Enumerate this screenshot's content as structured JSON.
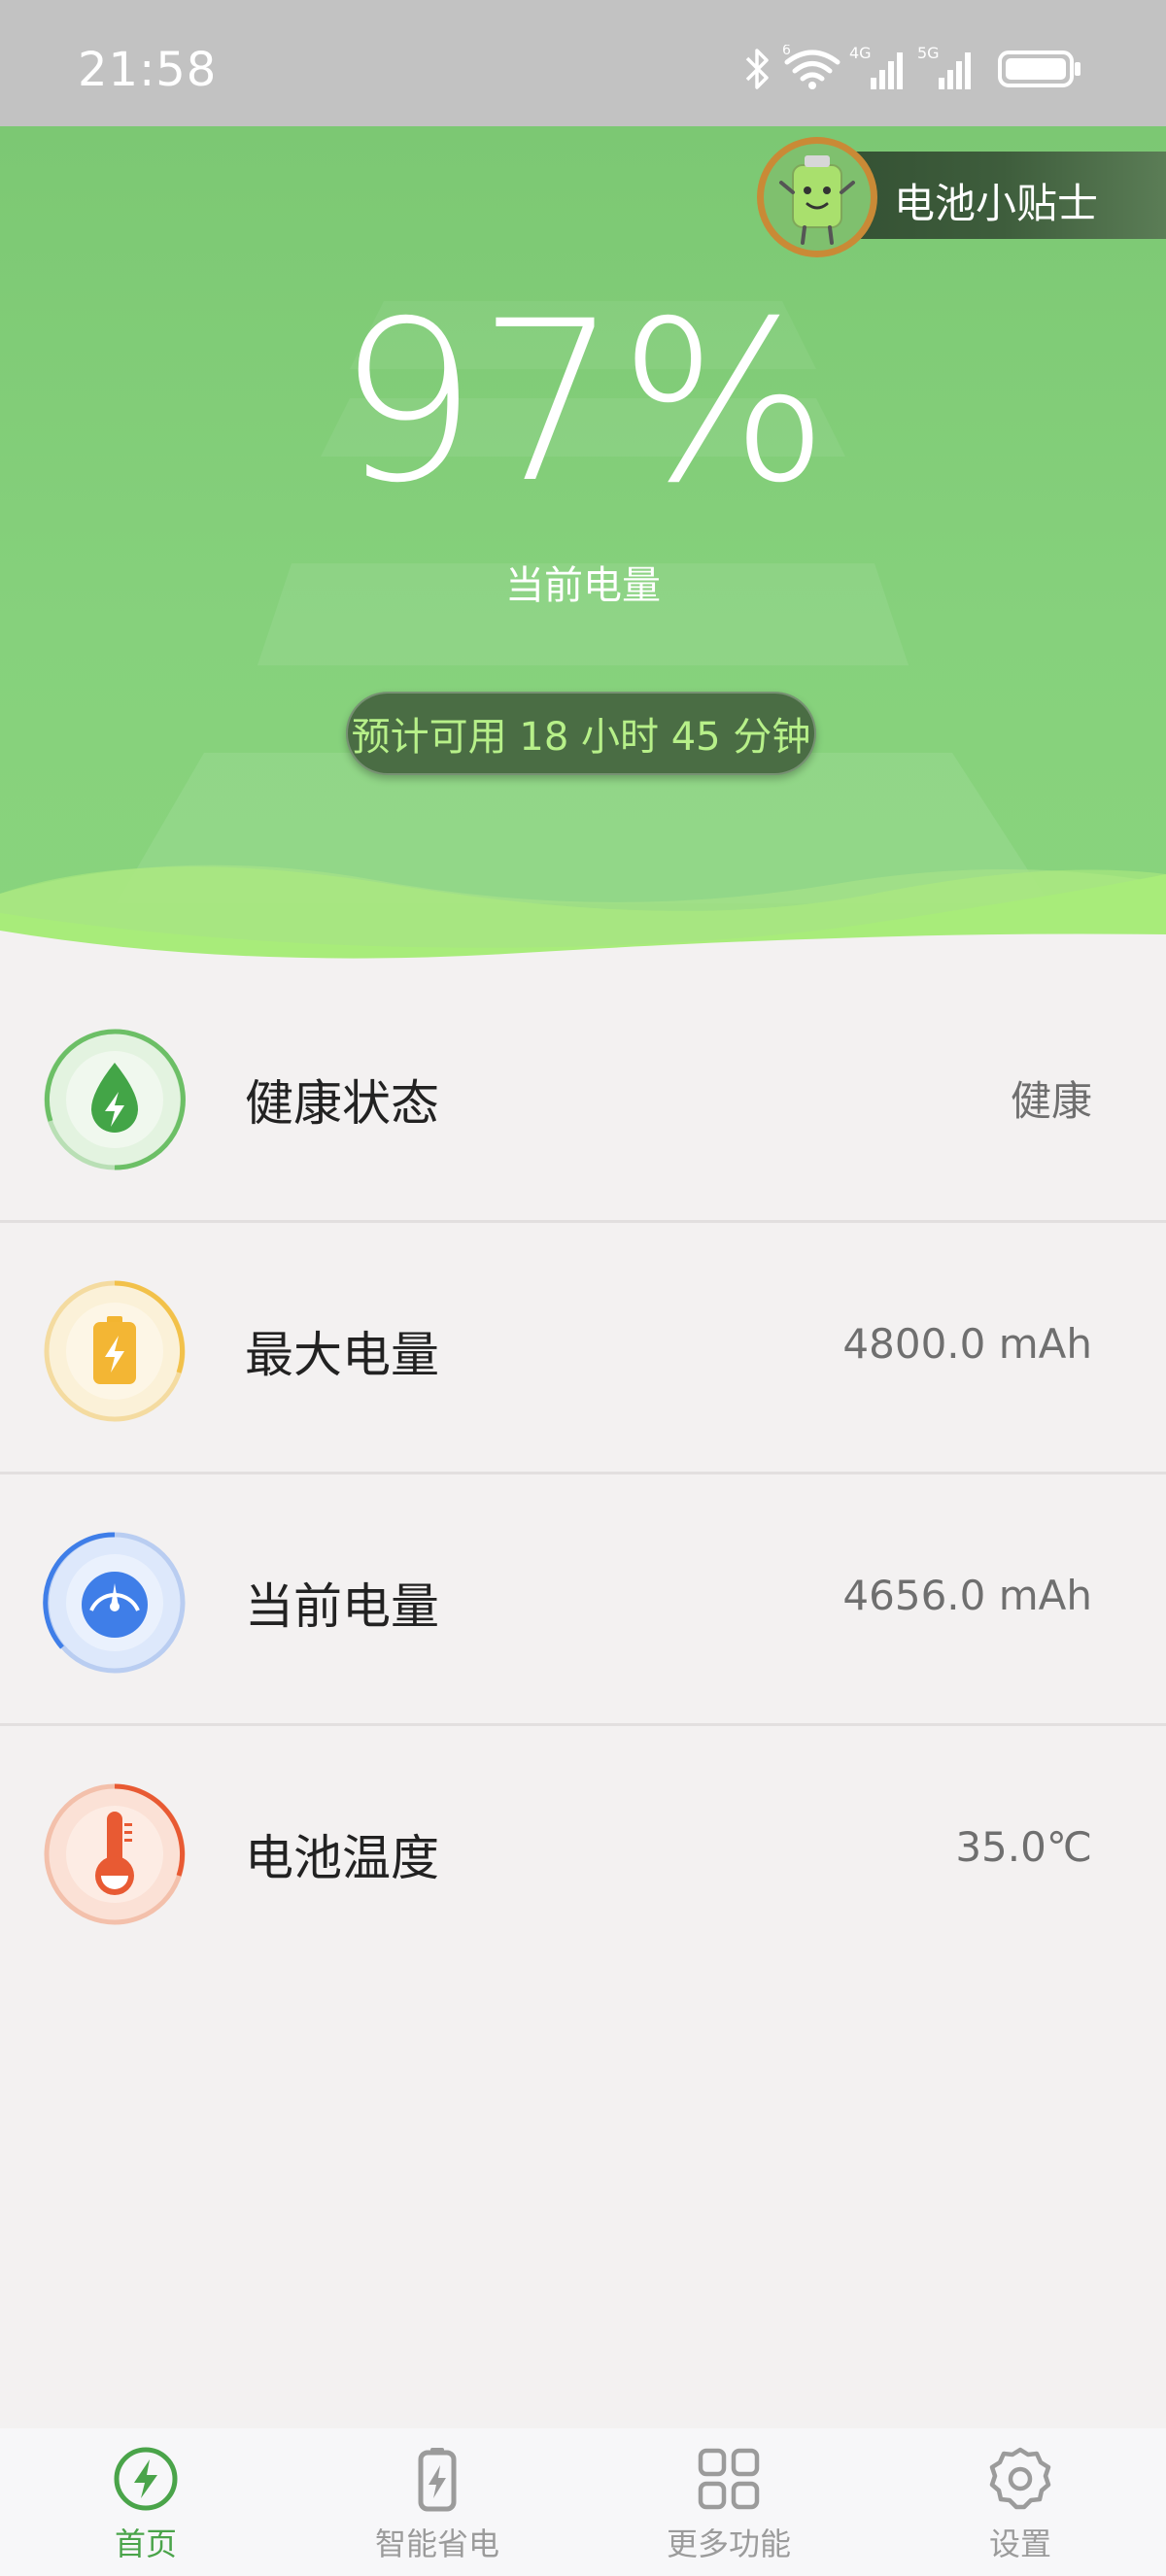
{
  "status_bar": {
    "time": "21:58",
    "icons": [
      "bluetooth-icon",
      "wifi-icon",
      "signal-4g-icon",
      "signal-5g-icon",
      "battery-icon"
    ],
    "wifi_badge": "6",
    "net1_label": "4G",
    "net2_label": "5G"
  },
  "hero": {
    "battery_percent": "97%",
    "battery_caption": "当前电量",
    "estimate_text": "预计可用 18 小时 45 分钟",
    "tips_label": "电池小贴士"
  },
  "info_rows": [
    {
      "label": "健康状态",
      "value": "健康",
      "icon": "health-drop-icon",
      "color": "#4caf50"
    },
    {
      "label": "最大电量",
      "value": "4800.0 mAh",
      "icon": "battery-bolt-icon",
      "color": "#f3b634"
    },
    {
      "label": "当前电量",
      "value": "4656.0 mAh",
      "icon": "gauge-icon",
      "color": "#3f7ee8"
    },
    {
      "label": "电池温度",
      "value": "35.0℃",
      "icon": "thermometer-icon",
      "color": "#e85a33"
    }
  ],
  "bottom_nav": [
    {
      "label": "首页",
      "icon": "bolt-circle-icon",
      "active": true
    },
    {
      "label": "智能省电",
      "icon": "battery-bolt-icon",
      "active": false
    },
    {
      "label": "更多功能",
      "icon": "grid-icon",
      "active": false
    },
    {
      "label": "设置",
      "icon": "gear-icon",
      "active": false
    }
  ],
  "colors": {
    "hero_green": "#86d17c",
    "accent_green": "#4aa44a",
    "estimate_text": "#b7f089"
  }
}
